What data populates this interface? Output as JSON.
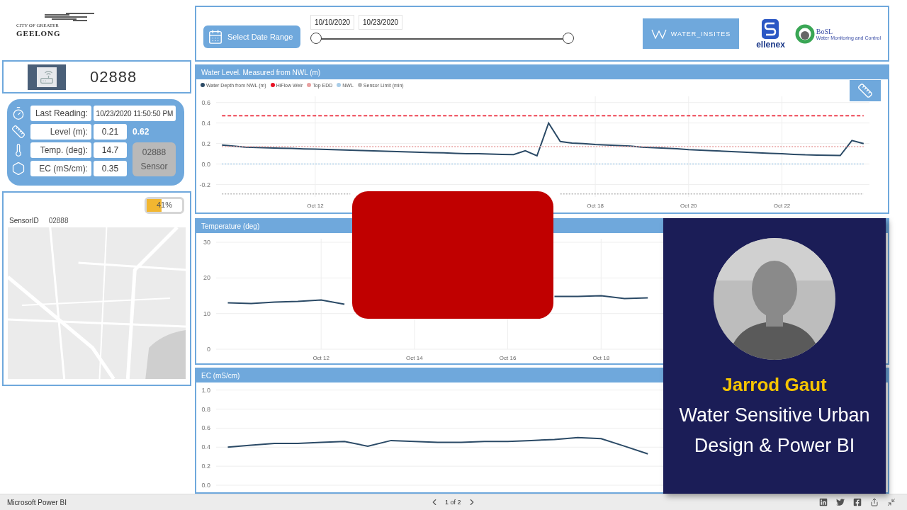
{
  "logo": {
    "small_text": "CITY OF GREATER",
    "name": "GEELONG"
  },
  "sensor": {
    "id": "02888"
  },
  "readings": [
    {
      "kind": "time",
      "label": "Last Reading:",
      "value": "10/23/2020 11:50:50 PM"
    },
    {
      "kind": "level",
      "label": "Level (m):",
      "value": "0.21",
      "extra": "0.62"
    },
    {
      "kind": "temp",
      "label": "Temp. (deg):",
      "value": "14.7"
    },
    {
      "kind": "ec",
      "label": "EC (mS/cm):",
      "value": "0.35"
    }
  ],
  "sensor_card": {
    "id": "02888",
    "label": "Sensor"
  },
  "battery": {
    "level": 0.41,
    "reading": "41%"
  },
  "sensor_id": {
    "label": "SensorID",
    "value": "02888"
  },
  "map": {
    "kind": "picture"
  },
  "date_range": {
    "button": "Select Date Range",
    "start": "10/10/2020",
    "end": "10/23/2020"
  },
  "partners": {
    "water_insites": "WATER_INSITES",
    "ellenex": "ellenex",
    "bosl": "BoSL",
    "bosl_tagline": "Water Monitoring and Control"
  },
  "charts": [
    {
      "title": "Water Level. Measured from NWL (m)",
      "chart_data": {
        "type": "line",
        "categories": [
          null,
          null,
          null,
          null,
          null,
          null,
          null,
          null,
          "Oct 12",
          null,
          null,
          null,
          null,
          null,
          null,
          null,
          null,
          null,
          null,
          null,
          null,
          null,
          null,
          null,
          null,
          null,
          null,
          null,
          null,
          null,
          null,
          null,
          "Oct 18",
          null,
          null,
          null,
          null,
          null,
          null,
          null,
          "Oct 20",
          null,
          null,
          null,
          null,
          null,
          null,
          null,
          "Oct 22",
          null,
          null,
          null,
          null,
          null,
          null,
          null
        ],
        "grid": true,
        "ylim": [
          -0.32,
          0.66
        ],
        "yticks": [
          {
            "value": -0.2,
            "label": "-0.2"
          },
          {
            "value": 0,
            "label": "0.0"
          },
          {
            "value": 0.2,
            "label": "0.2"
          },
          {
            "value": 0.4,
            "label": "0.4"
          },
          {
            "value": 0.6,
            "label": "0.6"
          }
        ],
        "series": [
          {
            "name": "Water Depth from NWL (m)",
            "color": "#2b4a66",
            "line_style": "solid",
            "values": [
              0.185,
              0.175,
              0.165,
              0.162,
              0.158,
              0.155,
              0.152,
              0.148,
              0.145,
              0.142,
              0.138,
              0.135,
              0.132,
              0.128,
              0.125,
              0.122,
              0.118,
              0.115,
              0.112,
              0.11,
              0.105,
              0.102,
              0.1,
              0.098,
              0.095,
              0.092,
              0.13,
              0.08,
              0.4,
              0.22,
              0.205,
              0.2,
              0.19,
              0.185,
              0.18,
              0.175,
              0.165,
              0.16,
              0.155,
              0.15,
              0.14,
              0.135,
              0.13,
              0.125,
              0.12,
              0.115,
              0.11,
              0.105,
              0.1,
              0.095,
              0.09,
              0.088,
              0.085,
              0.083,
              0.23,
              0.2
            ]
          },
          {
            "name": "HiFlow Weir",
            "color": "#e81123",
            "line_style": "dashed",
            "values": [
              0.47,
              0.47,
              0.47,
              0.47,
              0.47,
              0.47,
              0.47,
              0.47,
              0.47,
              0.47,
              0.47,
              0.47,
              0.47,
              0.47,
              0.47,
              0.47,
              0.47,
              0.47,
              0.47,
              0.47,
              0.47,
              0.47,
              0.47,
              0.47,
              0.47,
              0.47,
              0.47,
              0.47,
              0.47,
              0.47,
              0.47,
              0.47,
              0.47,
              0.47,
              0.47,
              0.47,
              0.47,
              0.47,
              0.47,
              0.47,
              0.47,
              0.47,
              0.47,
              0.47,
              0.47,
              0.47,
              0.47,
              0.47,
              0.47,
              0.47,
              0.47,
              0.47,
              0.47,
              0.47,
              0.47,
              0.47
            ]
          },
          {
            "name": "Top EDD",
            "color": "#e8a0a0",
            "line_style": "dotted",
            "values": [
              0.17,
              0.17,
              0.17,
              0.17,
              0.17,
              0.17,
              0.17,
              0.17,
              0.17,
              0.17,
              0.17,
              0.17,
              0.17,
              0.17,
              0.17,
              0.17,
              0.17,
              0.17,
              0.17,
              0.17,
              0.17,
              0.17,
              0.17,
              0.17,
              0.17,
              0.17,
              0.17,
              0.17,
              0.17,
              0.17,
              0.17,
              0.17,
              0.17,
              0.17,
              0.17,
              0.17,
              0.17,
              0.17,
              0.17,
              0.17,
              0.17,
              0.17,
              0.17,
              0.17,
              0.17,
              0.17,
              0.17,
              0.17,
              0.17,
              0.17,
              0.17,
              0.17,
              0.17,
              0.17,
              0.17,
              0.17
            ]
          },
          {
            "name": "NWL",
            "color": "#a9cde8",
            "line_style": "dotted",
            "values": [
              0,
              0,
              0,
              0,
              0,
              0,
              0,
              0,
              0,
              0,
              0,
              0,
              0,
              0,
              0,
              0,
              0,
              0,
              0,
              0,
              0,
              0,
              0,
              0,
              0,
              0,
              0,
              0,
              0,
              0,
              0,
              0,
              0,
              0,
              0,
              0,
              0,
              0,
              0,
              0,
              0,
              0,
              0,
              0,
              0,
              0,
              0,
              0,
              0,
              0,
              0,
              0,
              0,
              0,
              0,
              0
            ]
          },
          {
            "name": "Sensor Limit (min)",
            "color": "#b8b8b8",
            "line_style": "dotted",
            "values": [
              -0.29,
              -0.29,
              -0.29,
              -0.29,
              -0.29,
              -0.29,
              -0.29,
              -0.29,
              -0.29,
              -0.29,
              -0.29,
              -0.29,
              null,
              null,
              null,
              null,
              null,
              null,
              null,
              null,
              null,
              null,
              null,
              null,
              null,
              null,
              null,
              null,
              null,
              -0.29,
              -0.29,
              -0.29,
              -0.29,
              -0.29,
              -0.29,
              -0.29,
              -0.29,
              -0.29,
              -0.29,
              -0.29,
              -0.29,
              -0.29,
              -0.29,
              -0.29,
              -0.29,
              -0.29,
              -0.29,
              -0.29,
              -0.29,
              -0.29,
              -0.29,
              -0.29,
              -0.29,
              -0.29,
              -0.29,
              -0.29
            ]
          }
        ]
      }
    },
    {
      "title": "Temperature (deg)",
      "chart_data": {
        "type": "line",
        "categories": [
          null,
          null,
          null,
          null,
          "Oct 12",
          null,
          null,
          null,
          "Oct 14",
          null,
          null,
          null,
          "Oct 16",
          null,
          null,
          null,
          "Oct 18",
          null,
          null,
          null,
          null,
          null,
          null,
          null,
          null,
          null,
          null,
          null
        ],
        "grid": true,
        "ylim": [
          0,
          31
        ],
        "yticks": [
          0,
          10,
          20,
          30
        ],
        "series": [
          {
            "color": "#2b4a66",
            "line_style": "solid",
            "values": [
              13,
              12.8,
              13.2,
              13.4,
              13.8,
              12.6,
              null,
              null,
              null,
              null,
              null,
              null,
              null,
              null,
              14.8,
              14.8,
              15,
              14.2,
              14.4,
              null,
              null,
              null,
              null,
              null,
              null,
              null,
              null,
              null
            ]
          }
        ]
      }
    },
    {
      "title": "EC (mS/cm)",
      "chart_data": {
        "type": "line",
        "categories": [
          null,
          null,
          null,
          null,
          null,
          null,
          null,
          null,
          null,
          null,
          null,
          null,
          null,
          null,
          null,
          null,
          null,
          null,
          null,
          null,
          null,
          null,
          null,
          null,
          null,
          null,
          null,
          null
        ],
        "grid": true,
        "ylim": [
          0,
          1.02
        ],
        "yticks": [
          {
            "value": 0,
            "label": "0.0"
          },
          {
            "value": 0.2,
            "label": "0.2"
          },
          {
            "value": 0.4,
            "label": "0.4"
          },
          {
            "value": 0.6,
            "label": "0.6"
          },
          {
            "value": 0.8,
            "label": "0.8"
          },
          {
            "value": 1,
            "label": "1.0"
          }
        ],
        "series": [
          {
            "color": "#2b4a66",
            "line_style": "solid",
            "values": [
              0.4,
              0.42,
              0.44,
              0.44,
              0.45,
              0.46,
              0.41,
              0.47,
              0.46,
              0.45,
              0.45,
              0.46,
              0.46,
              0.47,
              0.48,
              0.5,
              0.49,
              0.41,
              0.33,
              null,
              null,
              null,
              null,
              null,
              null,
              null,
              null,
              null
            ]
          }
        ]
      }
    }
  ],
  "overlay_card": {
    "photo": {
      "kind": "picture"
    },
    "name": "Jarrod Gaut",
    "subtitle_lines": [
      "Water Sensitive Urban",
      "Design & Power BI"
    ]
  },
  "status_bar": {
    "app": "Microsoft Power BI",
    "page": "1 of 2"
  }
}
